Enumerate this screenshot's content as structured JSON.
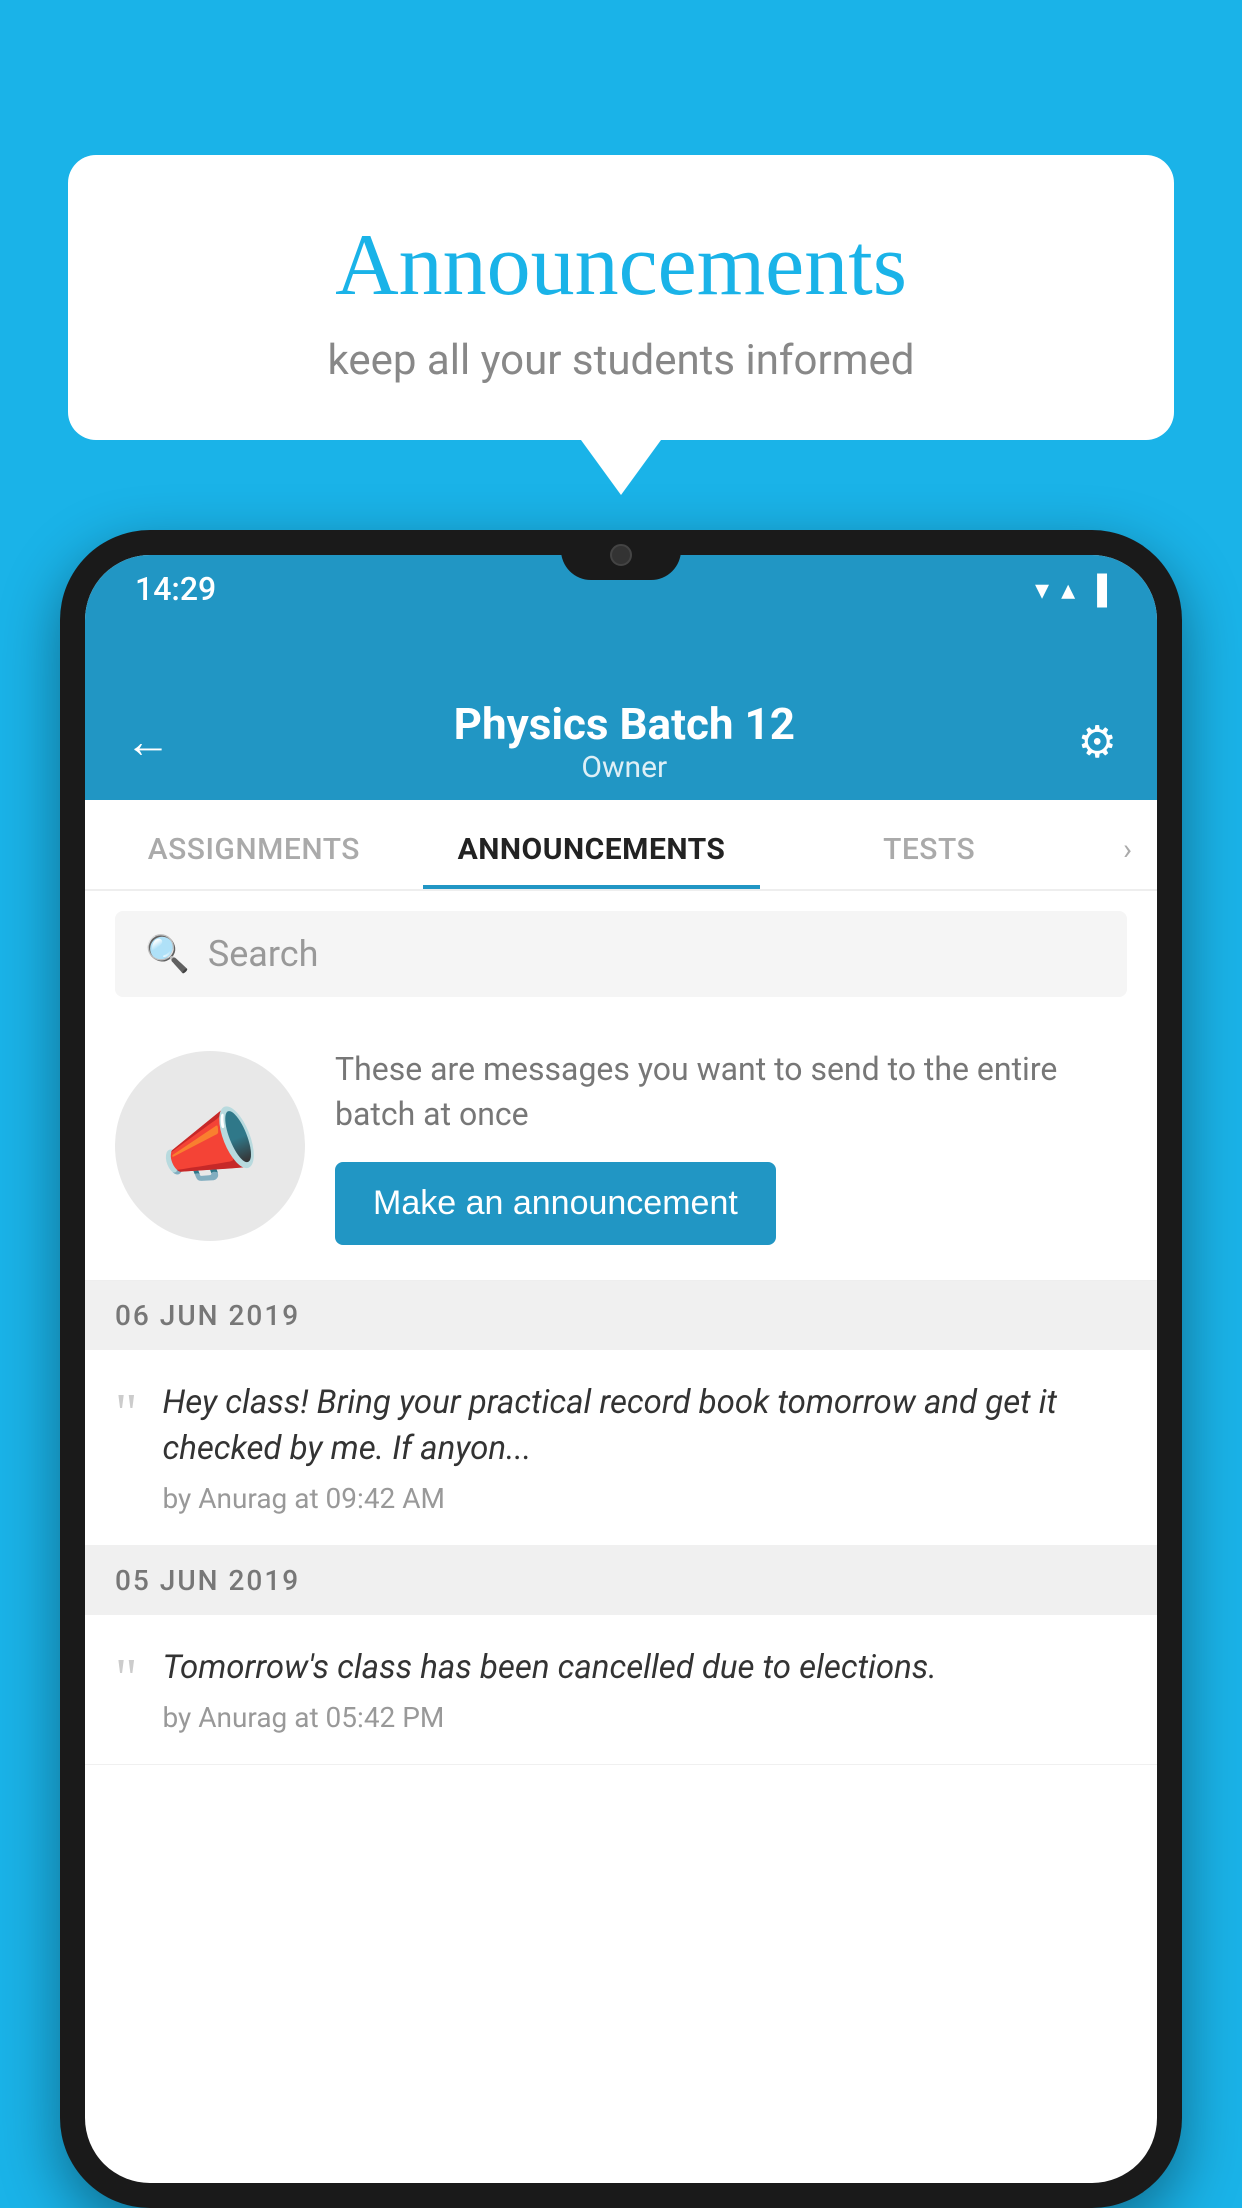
{
  "background_color": "#1ab3e8",
  "speech_bubble": {
    "title": "Announcements",
    "subtitle": "keep all your students informed"
  },
  "status_bar": {
    "time": "14:29",
    "wifi_icon": "▲",
    "signal_icon": "▲",
    "battery_icon": "▐"
  },
  "header": {
    "title": "Physics Batch 12",
    "subtitle": "Owner",
    "back_label": "←",
    "gear_label": "⚙"
  },
  "tabs": [
    {
      "label": "ASSIGNMENTS",
      "active": false
    },
    {
      "label": "ANNOUNCEMENTS",
      "active": true
    },
    {
      "label": "TESTS",
      "active": false
    }
  ],
  "search": {
    "placeholder": "Search"
  },
  "promo": {
    "description": "These are messages you want to send to the entire batch at once",
    "button_label": "Make an announcement"
  },
  "announcements": [
    {
      "date": "06  JUN  2019",
      "message": "Hey class! Bring your practical record book tomorrow and get it checked by me. If anyon...",
      "meta": "by Anurag at 09:42 AM"
    },
    {
      "date": "05  JUN  2019",
      "message": "Tomorrow's class has been cancelled due to elections.",
      "meta": "by Anurag at 05:42 PM"
    }
  ]
}
